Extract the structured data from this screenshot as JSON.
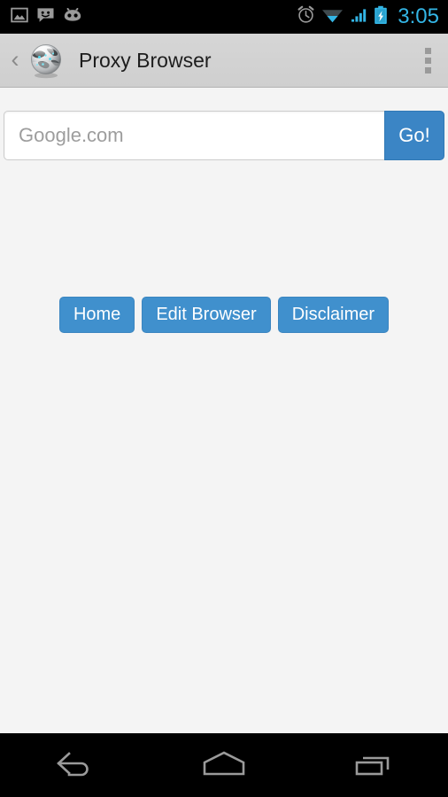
{
  "status_bar": {
    "background": "#000000",
    "notification_icons": [
      {
        "name": "image-icon",
        "label": "screenshot"
      },
      {
        "name": "chat-icon",
        "label": "messaging"
      },
      {
        "name": "cyanogenmod-icon",
        "label": "cyanogenmod"
      }
    ],
    "system_icons": [
      {
        "name": "alarm-icon",
        "label": "alarm set"
      },
      {
        "name": "wifi-icon",
        "label": "wifi connected"
      },
      {
        "name": "signal-icon",
        "label": "cellular signal"
      },
      {
        "name": "battery-charging-icon",
        "label": "battery charging"
      }
    ],
    "clock": "3:05",
    "clock_color": "#33b5e5"
  },
  "action_bar": {
    "back_chevron": "‹",
    "app_icon_name": "globe-icon",
    "title": "Proxy Browser",
    "overflow_label": "More options"
  },
  "main": {
    "url_bar": {
      "input_value": "",
      "input_placeholder": "Google.com",
      "go_label": "Go!",
      "go_color": "#3b85c5"
    },
    "nav_buttons": [
      {
        "name": "home-button",
        "label": "Home"
      },
      {
        "name": "edit-browser-button",
        "label": "Edit Browser"
      },
      {
        "name": "disclaimer-button",
        "label": "Disclaimer"
      }
    ],
    "button_color": "#4090cd",
    "background_color": "#f4f4f4"
  },
  "nav_bar": {
    "keys": [
      {
        "name": "back-nav-button",
        "label": "Back"
      },
      {
        "name": "home-nav-button",
        "label": "Home"
      },
      {
        "name": "recents-nav-button",
        "label": "Recent apps"
      }
    ],
    "background": "#000000",
    "icon_color": "#9a9a9a"
  }
}
